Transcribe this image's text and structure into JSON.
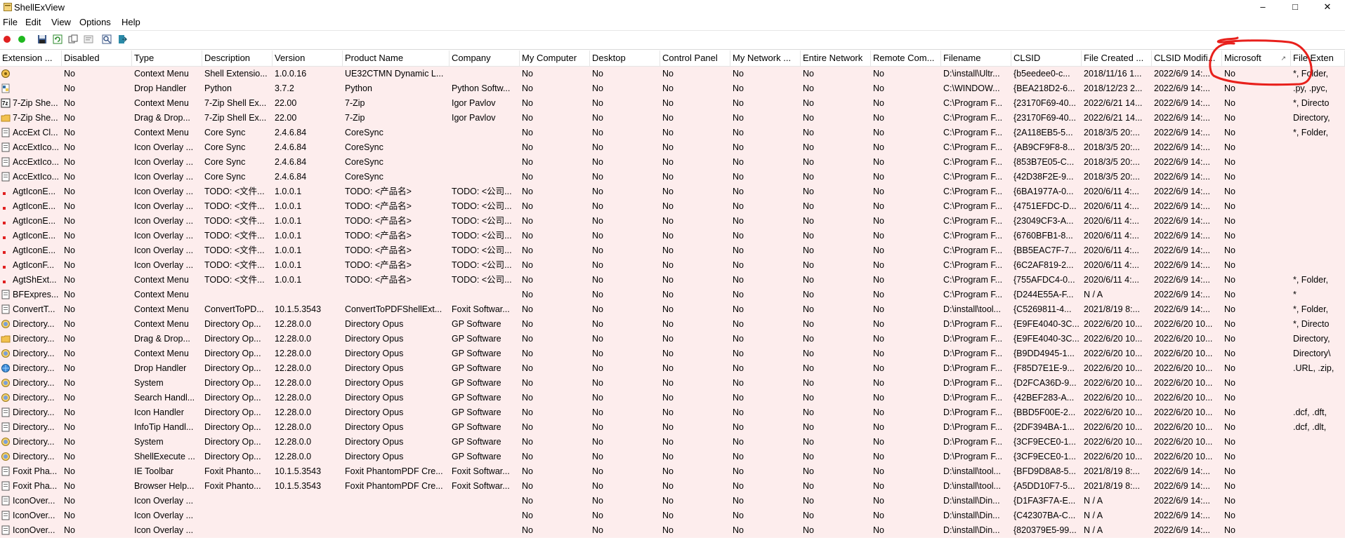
{
  "window": {
    "title": "ShellExView",
    "minimize": "–",
    "maximize": "□",
    "close": "✕"
  },
  "menu": [
    "File",
    "Edit",
    "View",
    "Options",
    "Help"
  ],
  "toolbar": {
    "icons": [
      "red-dot-icon",
      "green-dot-icon",
      "save-icon",
      "refresh-icon",
      "copy-icon",
      "html-report-icon",
      "find-icon",
      "exit-icon"
    ]
  },
  "columns": [
    "Extension ...",
    "Disabled",
    "Type",
    "Description",
    "Version",
    "Product Name",
    "Company",
    "My Computer",
    "Desktop",
    "Control Panel",
    "My Network ...",
    "Entire Network",
    "Remote Com...",
    "Filename",
    "CLSID",
    "File Created ...",
    "CLSID Modifi...",
    "Microsoft",
    "File Exten"
  ],
  "sort_column_indicator": "↗",
  "rows": [
    {
      "icon": "gear-yellow",
      "c": [
        "",
        "No",
        "Context Menu",
        "Shell Extensio...",
        "1.0.0.16",
        "UE32CTMN Dynamic L...",
        "",
        "No",
        "No",
        "No",
        "No",
        "No",
        "No",
        "D:\\install\\Ultr...",
        "{b5eedee0-c...",
        "2018/11/16 1...",
        "2022/6/9 14:...",
        "No",
        "*, Folder,"
      ]
    },
    {
      "icon": "python",
      "c": [
        "",
        "No",
        "Drop Handler",
        "Python",
        "3.7.2",
        "Python",
        "Python Softw...",
        "No",
        "No",
        "No",
        "No",
        "No",
        "No",
        "C:\\WINDOW...",
        "{BEA218D2-6...",
        "2018/12/23 2...",
        "2022/6/9 14:...",
        "No",
        ".py, .pyc,"
      ]
    },
    {
      "icon": "7z",
      "c": [
        "7-Zip She...",
        "No",
        "Context Menu",
        "7-Zip Shell Ex...",
        "22.00",
        "7-Zip",
        "Igor Pavlov",
        "No",
        "No",
        "No",
        "No",
        "No",
        "No",
        "C:\\Program F...",
        "{23170F69-40...",
        "2022/6/21 14...",
        "2022/6/9 14:...",
        "No",
        "*, Directo"
      ]
    },
    {
      "icon": "folder",
      "c": [
        "7-Zip She...",
        "No",
        "Drag & Drop...",
        "7-Zip Shell Ex...",
        "22.00",
        "7-Zip",
        "Igor Pavlov",
        "No",
        "No",
        "No",
        "No",
        "No",
        "No",
        "C:\\Program F...",
        "{23170F69-40...",
        "2022/6/21 14...",
        "2022/6/9 14:...",
        "No",
        "Directory,"
      ]
    },
    {
      "icon": "doc",
      "c": [
        "AccExt Cl...",
        "No",
        "Context Menu",
        "Core Sync",
        "2.4.6.84",
        "CoreSync",
        "",
        "No",
        "No",
        "No",
        "No",
        "No",
        "No",
        "C:\\Program F...",
        "{2A118EB5-5...",
        "2018/3/5 20:...",
        "2022/6/9 14:...",
        "No",
        "*, Folder,"
      ]
    },
    {
      "icon": "doc",
      "c": [
        "AccExtIco...",
        "No",
        "Icon Overlay ...",
        "Core Sync",
        "2.4.6.84",
        "CoreSync",
        "",
        "No",
        "No",
        "No",
        "No",
        "No",
        "No",
        "C:\\Program F...",
        "{AB9CF9F8-8...",
        "2018/3/5 20:...",
        "2022/6/9 14:...",
        "No",
        ""
      ]
    },
    {
      "icon": "doc",
      "c": [
        "AccExtIco...",
        "No",
        "Icon Overlay ...",
        "Core Sync",
        "2.4.6.84",
        "CoreSync",
        "",
        "No",
        "No",
        "No",
        "No",
        "No",
        "No",
        "C:\\Program F...",
        "{853B7E05-C...",
        "2018/3/5 20:...",
        "2022/6/9 14:...",
        "No",
        ""
      ]
    },
    {
      "icon": "doc",
      "c": [
        "AccExtIco...",
        "No",
        "Icon Overlay ...",
        "Core Sync",
        "2.4.6.84",
        "CoreSync",
        "",
        "No",
        "No",
        "No",
        "No",
        "No",
        "No",
        "C:\\Program F...",
        "{42D38F2E-9...",
        "2018/3/5 20:...",
        "2022/6/9 14:...",
        "No",
        ""
      ]
    },
    {
      "icon": "red-mark",
      "c": [
        "AgtIconE...",
        "No",
        "Icon Overlay ...",
        "TODO: <文件...",
        "1.0.0.1",
        "TODO: <产品名>",
        "TODO: <公司...",
        "No",
        "No",
        "No",
        "No",
        "No",
        "No",
        "C:\\Program F...",
        "{6BA1977A-0...",
        "2020/6/11 4:...",
        "2022/6/9 14:...",
        "No",
        ""
      ]
    },
    {
      "icon": "red-mark",
      "c": [
        "AgtIconE...",
        "No",
        "Icon Overlay ...",
        "TODO: <文件...",
        "1.0.0.1",
        "TODO: <产品名>",
        "TODO: <公司...",
        "No",
        "No",
        "No",
        "No",
        "No",
        "No",
        "C:\\Program F...",
        "{4751EFDC-D...",
        "2020/6/11 4:...",
        "2022/6/9 14:...",
        "No",
        ""
      ]
    },
    {
      "icon": "red-mark",
      "c": [
        "AgtIconE...",
        "No",
        "Icon Overlay ...",
        "TODO: <文件...",
        "1.0.0.1",
        "TODO: <产品名>",
        "TODO: <公司...",
        "No",
        "No",
        "No",
        "No",
        "No",
        "No",
        "C:\\Program F...",
        "{23049CF3-A...",
        "2020/6/11 4:...",
        "2022/6/9 14:...",
        "No",
        ""
      ]
    },
    {
      "icon": "red-mark",
      "c": [
        "AgtIconE...",
        "No",
        "Icon Overlay ...",
        "TODO: <文件...",
        "1.0.0.1",
        "TODO: <产品名>",
        "TODO: <公司...",
        "No",
        "No",
        "No",
        "No",
        "No",
        "No",
        "C:\\Program F...",
        "{6760BFB1-8...",
        "2020/6/11 4:...",
        "2022/6/9 14:...",
        "No",
        ""
      ]
    },
    {
      "icon": "red-mark",
      "c": [
        "AgtIconE...",
        "No",
        "Icon Overlay ...",
        "TODO: <文件...",
        "1.0.0.1",
        "TODO: <产品名>",
        "TODO: <公司...",
        "No",
        "No",
        "No",
        "No",
        "No",
        "No",
        "C:\\Program F...",
        "{BB5EAC7F-7...",
        "2020/6/11 4:...",
        "2022/6/9 14:...",
        "No",
        ""
      ]
    },
    {
      "icon": "red-mark",
      "c": [
        "AgtIconF...",
        "No",
        "Icon Overlay ...",
        "TODO: <文件...",
        "1.0.0.1",
        "TODO: <产品名>",
        "TODO: <公司...",
        "No",
        "No",
        "No",
        "No",
        "No",
        "No",
        "C:\\Program F...",
        "{6C2AF819-2...",
        "2020/6/11 4:...",
        "2022/6/9 14:...",
        "No",
        ""
      ]
    },
    {
      "icon": "red-mark",
      "c": [
        "AgtShExt...",
        "No",
        "Context Menu",
        "TODO: <文件...",
        "1.0.0.1",
        "TODO: <产品名>",
        "TODO: <公司...",
        "No",
        "No",
        "No",
        "No",
        "No",
        "No",
        "C:\\Program F...",
        "{755AFDC4-0...",
        "2020/6/11 4:...",
        "2022/6/9 14:...",
        "No",
        "*, Folder,"
      ]
    },
    {
      "icon": "doc",
      "c": [
        "BFExpres...",
        "No",
        "Context Menu",
        "",
        "",
        "",
        "",
        "No",
        "No",
        "No",
        "No",
        "No",
        "No",
        "C:\\Program F...",
        "{D244E55A-F...",
        "N / A",
        "2022/6/9 14:...",
        "No",
        "*"
      ]
    },
    {
      "icon": "doc",
      "c": [
        "ConvertT...",
        "No",
        "Context Menu",
        "ConvertToPD...",
        "10.1.5.3543",
        "ConvertToPDFShellExt...",
        "Foxit Softwar...",
        "No",
        "No",
        "No",
        "No",
        "No",
        "No",
        "D:\\install\\tool...",
        "{C5269811-4...",
        "2021/8/19 8:...",
        "2022/6/9 14:...",
        "No",
        "*, Folder,"
      ]
    },
    {
      "icon": "dopus",
      "c": [
        "Directory...",
        "No",
        "Context Menu",
        "Directory Op...",
        "12.28.0.0",
        "Directory Opus",
        "GP Software",
        "No",
        "No",
        "No",
        "No",
        "No",
        "No",
        "D:\\Program F...",
        "{E9FE4040-3C...",
        "2022/6/20 10...",
        "2022/6/20 10...",
        "No",
        "*, Directo"
      ]
    },
    {
      "icon": "folder",
      "c": [
        "Directory...",
        "No",
        "Drag & Drop...",
        "Directory Op...",
        "12.28.0.0",
        "Directory Opus",
        "GP Software",
        "No",
        "No",
        "No",
        "No",
        "No",
        "No",
        "D:\\Program F...",
        "{E9FE4040-3C...",
        "2022/6/20 10...",
        "2022/6/20 10...",
        "No",
        "Directory,"
      ]
    },
    {
      "icon": "dopus",
      "c": [
        "Directory...",
        "No",
        "Context Menu",
        "Directory Op...",
        "12.28.0.0",
        "Directory Opus",
        "GP Software",
        "No",
        "No",
        "No",
        "No",
        "No",
        "No",
        "D:\\Program F...",
        "{B9DD4945-1...",
        "2022/6/20 10...",
        "2022/6/20 10...",
        "No",
        "Directory\\"
      ]
    },
    {
      "icon": "globe",
      "c": [
        "Directory...",
        "No",
        "Drop Handler",
        "Directory Op...",
        "12.28.0.0",
        "Directory Opus",
        "GP Software",
        "No",
        "No",
        "No",
        "No",
        "No",
        "No",
        "D:\\Program F...",
        "{F85D7E1E-9...",
        "2022/6/20 10...",
        "2022/6/20 10...",
        "No",
        ".URL, .zip,"
      ]
    },
    {
      "icon": "dopus",
      "c": [
        "Directory...",
        "No",
        "System",
        "Directory Op...",
        "12.28.0.0",
        "Directory Opus",
        "GP Software",
        "No",
        "No",
        "No",
        "No",
        "No",
        "No",
        "D:\\Program F...",
        "{D2FCA36D-9...",
        "2022/6/20 10...",
        "2022/6/20 10...",
        "No",
        ""
      ]
    },
    {
      "icon": "dopus",
      "c": [
        "Directory...",
        "No",
        "Search Handl...",
        "Directory Op...",
        "12.28.0.0",
        "Directory Opus",
        "GP Software",
        "No",
        "No",
        "No",
        "No",
        "No",
        "No",
        "D:\\Program F...",
        "{42BEF283-A...",
        "2022/6/20 10...",
        "2022/6/20 10...",
        "No",
        ""
      ]
    },
    {
      "icon": "doc",
      "c": [
        "Directory...",
        "No",
        "Icon Handler",
        "Directory Op...",
        "12.28.0.0",
        "Directory Opus",
        "GP Software",
        "No",
        "No",
        "No",
        "No",
        "No",
        "No",
        "D:\\Program F...",
        "{BBD5F00E-2...",
        "2022/6/20 10...",
        "2022/6/20 10...",
        "No",
        ".dcf, .dft,"
      ]
    },
    {
      "icon": "doc",
      "c": [
        "Directory...",
        "No",
        "InfoTip Handl...",
        "Directory Op...",
        "12.28.0.0",
        "Directory Opus",
        "GP Software",
        "No",
        "No",
        "No",
        "No",
        "No",
        "No",
        "D:\\Program F...",
        "{2DF394BA-1...",
        "2022/6/20 10...",
        "2022/6/20 10...",
        "No",
        ".dcf, .dlt,"
      ]
    },
    {
      "icon": "dopus",
      "c": [
        "Directory...",
        "No",
        "System",
        "Directory Op...",
        "12.28.0.0",
        "Directory Opus",
        "GP Software",
        "No",
        "No",
        "No",
        "No",
        "No",
        "No",
        "D:\\Program F...",
        "{3CF9ECE0-1...",
        "2022/6/20 10...",
        "2022/6/20 10...",
        "No",
        ""
      ]
    },
    {
      "icon": "dopus",
      "c": [
        "Directory...",
        "No",
        "ShellExecute ...",
        "Directory Op...",
        "12.28.0.0",
        "Directory Opus",
        "GP Software",
        "No",
        "No",
        "No",
        "No",
        "No",
        "No",
        "D:\\Program F...",
        "{3CF9ECE0-1...",
        "2022/6/20 10...",
        "2022/6/20 10...",
        "No",
        ""
      ]
    },
    {
      "icon": "doc",
      "c": [
        "Foxit Pha...",
        "No",
        "IE Toolbar",
        "Foxit Phanto...",
        "10.1.5.3543",
        "Foxit PhantomPDF Cre...",
        "Foxit Softwar...",
        "No",
        "No",
        "No",
        "No",
        "No",
        "No",
        "D:\\install\\tool...",
        "{BFD9D8A8-5...",
        "2021/8/19 8:...",
        "2022/6/9 14:...",
        "No",
        ""
      ]
    },
    {
      "icon": "doc",
      "c": [
        "Foxit Pha...",
        "No",
        "Browser Help...",
        "Foxit Phanto...",
        "10.1.5.3543",
        "Foxit PhantomPDF Cre...",
        "Foxit Softwar...",
        "No",
        "No",
        "No",
        "No",
        "No",
        "No",
        "D:\\install\\tool...",
        "{A5DD10F7-5...",
        "2021/8/19 8:...",
        "2022/6/9 14:...",
        "No",
        ""
      ]
    },
    {
      "icon": "doc",
      "c": [
        "IconOver...",
        "No",
        "Icon Overlay ...",
        "",
        "",
        "",
        "",
        "No",
        "No",
        "No",
        "No",
        "No",
        "No",
        "D:\\install\\Din...",
        "{D1FA3F7A-E...",
        "N / A",
        "2022/6/9 14:...",
        "No",
        ""
      ]
    },
    {
      "icon": "doc",
      "c": [
        "IconOver...",
        "No",
        "Icon Overlay ...",
        "",
        "",
        "",
        "",
        "No",
        "No",
        "No",
        "No",
        "No",
        "No",
        "D:\\install\\Din...",
        "{C42307BA-C...",
        "N / A",
        "2022/6/9 14:...",
        "No",
        ""
      ]
    },
    {
      "icon": "doc",
      "c": [
        "IconOver...",
        "No",
        "Icon Overlay ...",
        "",
        "",
        "",
        "",
        "No",
        "No",
        "No",
        "No",
        "No",
        "No",
        "D:\\install\\Din...",
        "{820379E5-99...",
        "N / A",
        "2022/6/9 14:...",
        "No",
        ""
      ]
    }
  ],
  "colors": {
    "row_background": "#fdeded",
    "annotation_stroke": "#e8201c"
  }
}
